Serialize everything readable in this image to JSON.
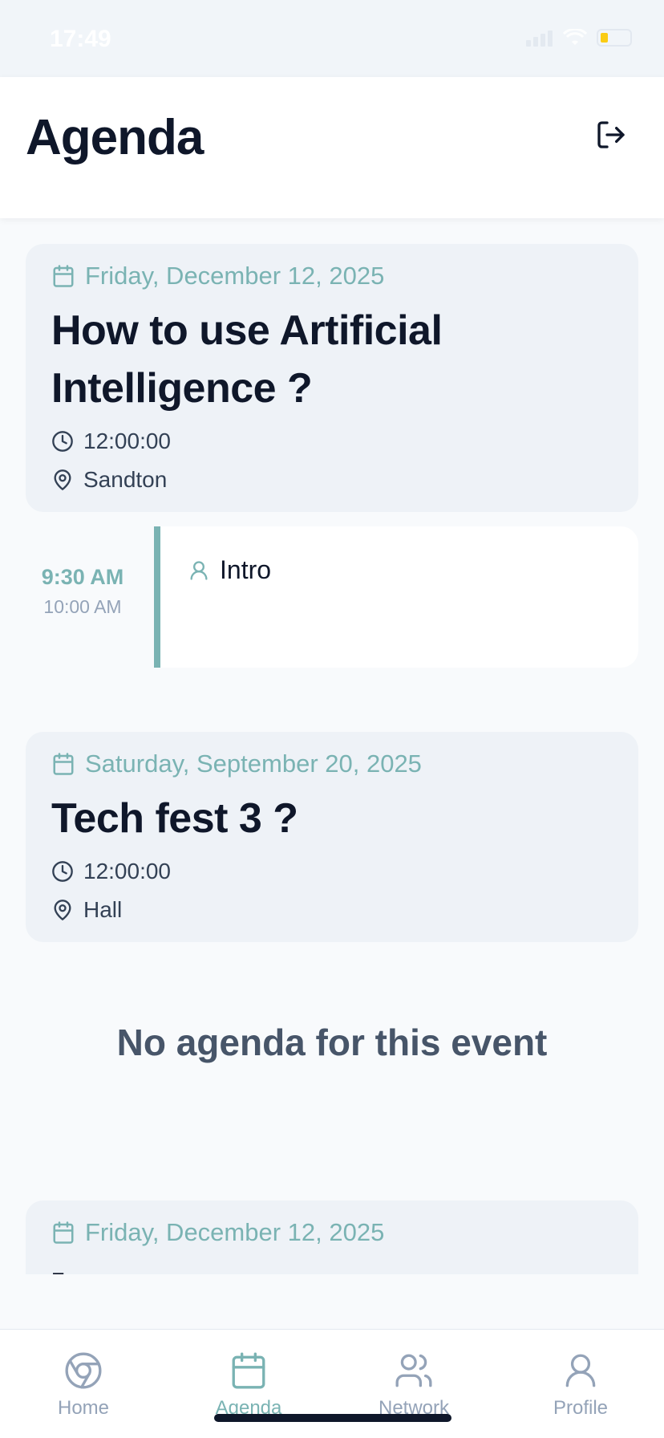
{
  "status_bar": {
    "time": "17:49"
  },
  "header": {
    "title": "Agenda"
  },
  "events": [
    {
      "date": "Friday, December 12, 2025",
      "title": "How to use Artificial Intelligence ?",
      "time": "12:00:00",
      "location": "Sandton",
      "sessions": [
        {
          "start": "9:30 AM",
          "end": "10:00 AM",
          "title": "Intro"
        }
      ]
    },
    {
      "date": "Saturday, September 20, 2025",
      "title": "Tech fest 3 ?",
      "time": "12:00:00",
      "location": "Hall",
      "empty_message": "No agenda for this event"
    },
    {
      "date": "Friday, December 12, 2025",
      "title": "-"
    }
  ],
  "tabs": [
    {
      "label": "Home",
      "icon": "chrome-icon",
      "active": false
    },
    {
      "label": "Agenda",
      "icon": "calendar-icon",
      "active": true
    },
    {
      "label": "Network",
      "icon": "users-icon",
      "active": false
    },
    {
      "label": "Profile",
      "icon": "user-icon",
      "active": false
    }
  ],
  "colors": {
    "accent": "#7AB3B3",
    "text": "#0F172A",
    "card": "#EEF2F7",
    "muted": "#94A3B8"
  }
}
